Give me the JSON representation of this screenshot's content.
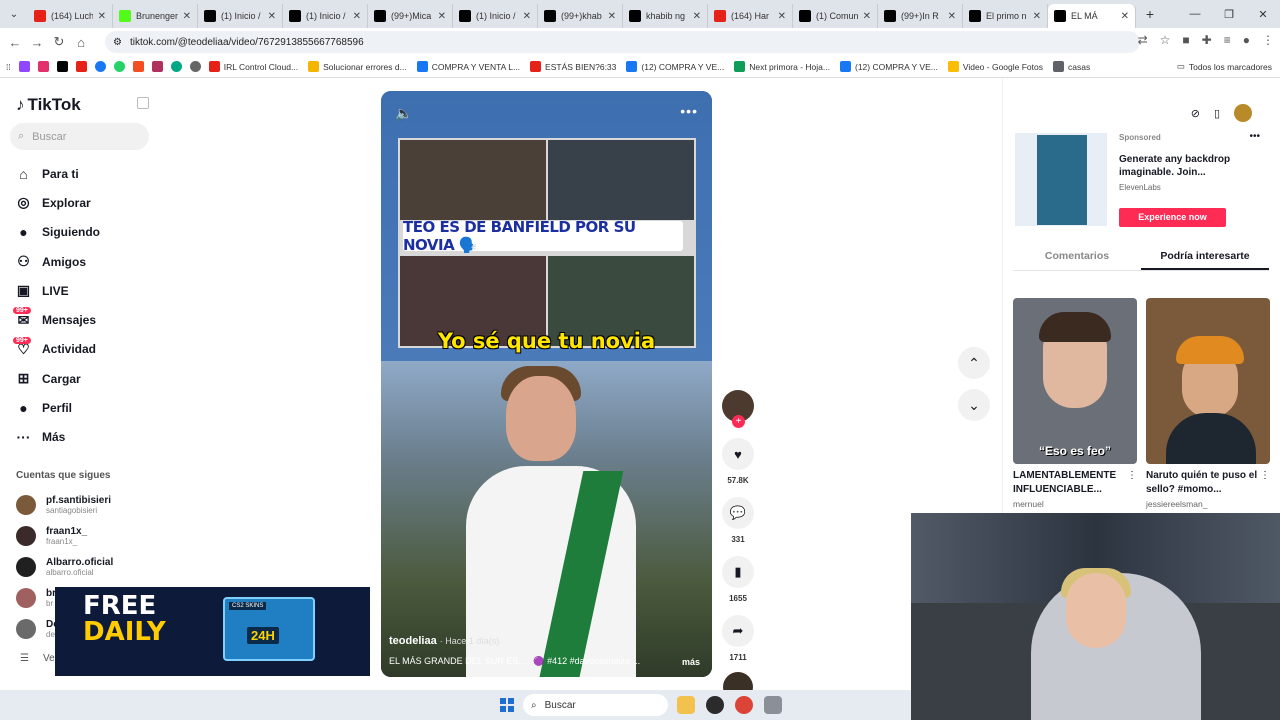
{
  "browser": {
    "tabs": [
      {
        "label": "(164) Luch",
        "color": "#e62117"
      },
      {
        "label": "Brunenger",
        "color": "#53fc18"
      },
      {
        "label": "(1) Inicio /",
        "color": "#000000"
      },
      {
        "label": "(1) Inicio /",
        "color": "#000000"
      },
      {
        "label": "(99+)Mica",
        "color": "#000000"
      },
      {
        "label": "(1) Inicio /",
        "color": "#000000"
      },
      {
        "label": "(99+)khab",
        "color": "#000000"
      },
      {
        "label": "khabib ng",
        "color": "#000000"
      },
      {
        "label": "(164) Har",
        "color": "#e62117"
      },
      {
        "label": "(1) Comun",
        "color": "#000000"
      },
      {
        "label": "(99+)In R",
        "color": "#000000"
      },
      {
        "label": "El primo n",
        "color": "#000000"
      },
      {
        "label": "EL MÁ",
        "color": "#000000"
      }
    ],
    "url": "tiktok.com/@teodeliaa/video/7672913855667768596",
    "bookmarks": [
      {
        "label": "IRL Control Cloud...",
        "color": "#e62117"
      },
      {
        "label": "Solucionar errores d...",
        "color": "#f4b400"
      },
      {
        "label": "COMPRA Y VENTA L...",
        "color": "#1877f2"
      },
      {
        "label": "ESTÁS BIEN?6:33",
        "color": "#e62117"
      },
      {
        "label": "(12) COMPRA Y VE...",
        "color": "#1877f2"
      },
      {
        "label": "Next primora - Hoja...",
        "color": "#0f9d58"
      },
      {
        "label": "(12) COMPRA Y VE...",
        "color": "#1877f2"
      },
      {
        "label": "Video - Google Fotos",
        "color": "#fbbc05"
      },
      {
        "label": "casas",
        "color": "#5f6368"
      }
    ],
    "all_bookmarks": "Todos los marcadores"
  },
  "sidebar": {
    "logo": "TikTok",
    "search_placeholder": "Buscar",
    "nav": [
      {
        "label": "Para ti",
        "icon": "home-icon",
        "glyph": "⌂"
      },
      {
        "label": "Explorar",
        "icon": "compass-icon",
        "glyph": "◎"
      },
      {
        "label": "Siguiendo",
        "icon": "following-icon",
        "glyph": "●"
      },
      {
        "label": "Amigos",
        "icon": "friends-icon",
        "glyph": "⚇"
      },
      {
        "label": "LIVE",
        "icon": "live-icon",
        "glyph": "▣"
      },
      {
        "label": "Mensajes",
        "icon": "messages-icon",
        "glyph": "✉",
        "badge": "99+"
      },
      {
        "label": "Actividad",
        "icon": "activity-icon",
        "glyph": "♡",
        "badge": "99+"
      },
      {
        "label": "Cargar",
        "icon": "upload-icon",
        "glyph": "⊞"
      },
      {
        "label": "Perfil",
        "icon": "profile-icon",
        "glyph": "●"
      },
      {
        "label": "Más",
        "icon": "more-icon",
        "glyph": "···"
      }
    ],
    "following_title": "Cuentas que sigues",
    "following": [
      {
        "name": "pf.santibisieri",
        "handle": "santiagobisieri",
        "color": "#7a5a3a"
      },
      {
        "name": "fraan1x_",
        "handle": "fraan1x_",
        "color": "#3a2a2a"
      },
      {
        "name": "Albarro.oficial",
        "handle": "albarro.oficial",
        "color": "#202020"
      },
      {
        "name": "br",
        "handle": "br",
        "color": "#a06060"
      },
      {
        "name": "De",
        "handle": "de",
        "color": "#6a6a6a"
      }
    ],
    "see_more": "Ve"
  },
  "overlay_ad": {
    "line1": "FREE",
    "line2": "DAILY",
    "badge": "24H",
    "brand": "CS2 SKINS"
  },
  "video": {
    "banner": "TEO ES DE BANFIELD POR SU NOVIA 🗣️",
    "caption": "Yo sé que tu novia",
    "author": "teodeliaa",
    "ago": "Hace 1 día(s)",
    "description": "EL MÁS GRANDE DEL SUR ES..... 🟣 #412 #davooxeneize ...",
    "more": "más"
  },
  "actions": {
    "likes": "57.8K",
    "comments": "331",
    "saves": "1655",
    "shares": "1711"
  },
  "right": {
    "sponsored": {
      "label": "Sponsored",
      "title": "Generate any backdrop imaginable. Join...",
      "brand": "ElevenLabs",
      "cta": "Experience now"
    },
    "tabs": [
      "Comentarios",
      "Podría interesarte"
    ],
    "suggestions": [
      {
        "caption": "“Eso es feo”",
        "title": "LAMENTABLEMENTE INFLUENCIABLE...",
        "author": "mernuel",
        "color": "#6a6f78"
      },
      {
        "caption": "",
        "title": "Naruto quién te puso el sello? #momo...",
        "author": "jessiereelsman_",
        "color": "#7a5a3a"
      }
    ]
  },
  "taskbar": {
    "search": "Buscar"
  }
}
